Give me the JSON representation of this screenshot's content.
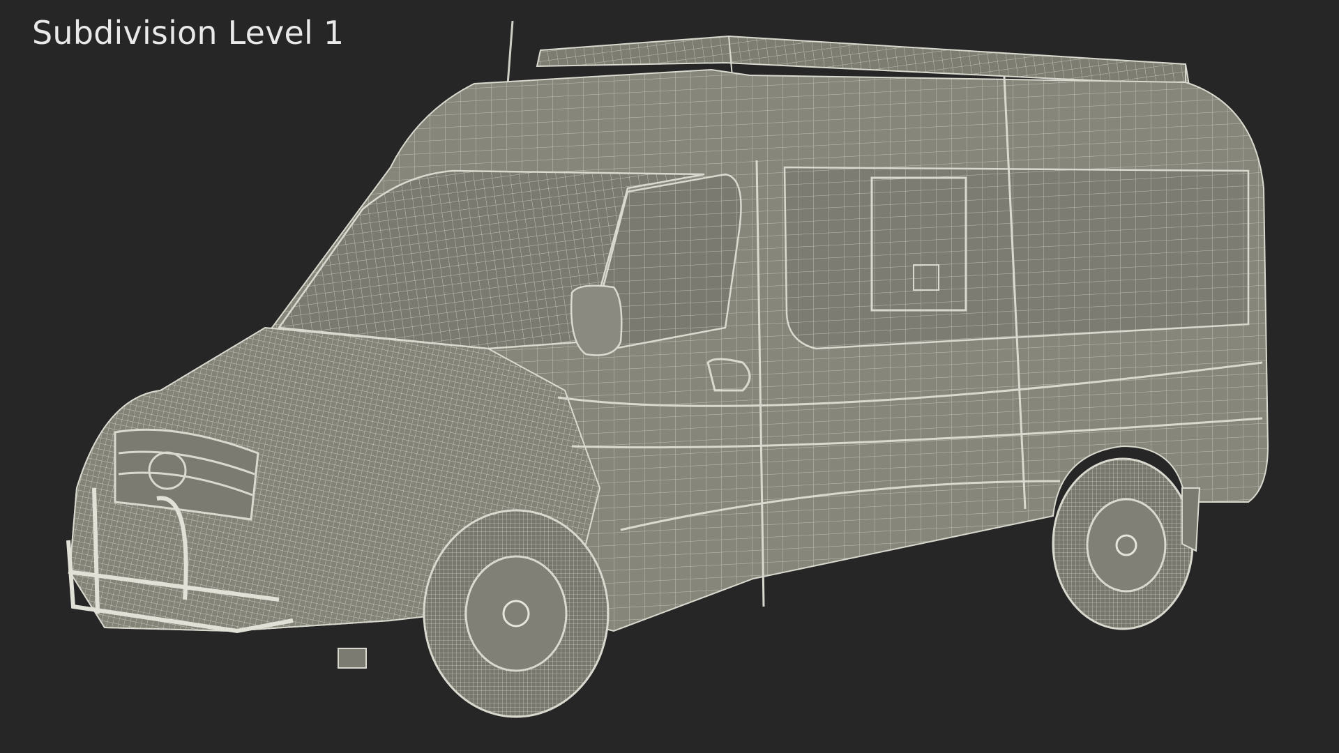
{
  "overlay": {
    "title": "Subdivision Level 1"
  },
  "colors": {
    "background": "#262626",
    "surface": "#86867b",
    "surface_dark": "#6c6c63",
    "wire": "#d9d9cf",
    "title_text": "#e9e9e9"
  },
  "model": {
    "name": "van-wireframe-render"
  }
}
